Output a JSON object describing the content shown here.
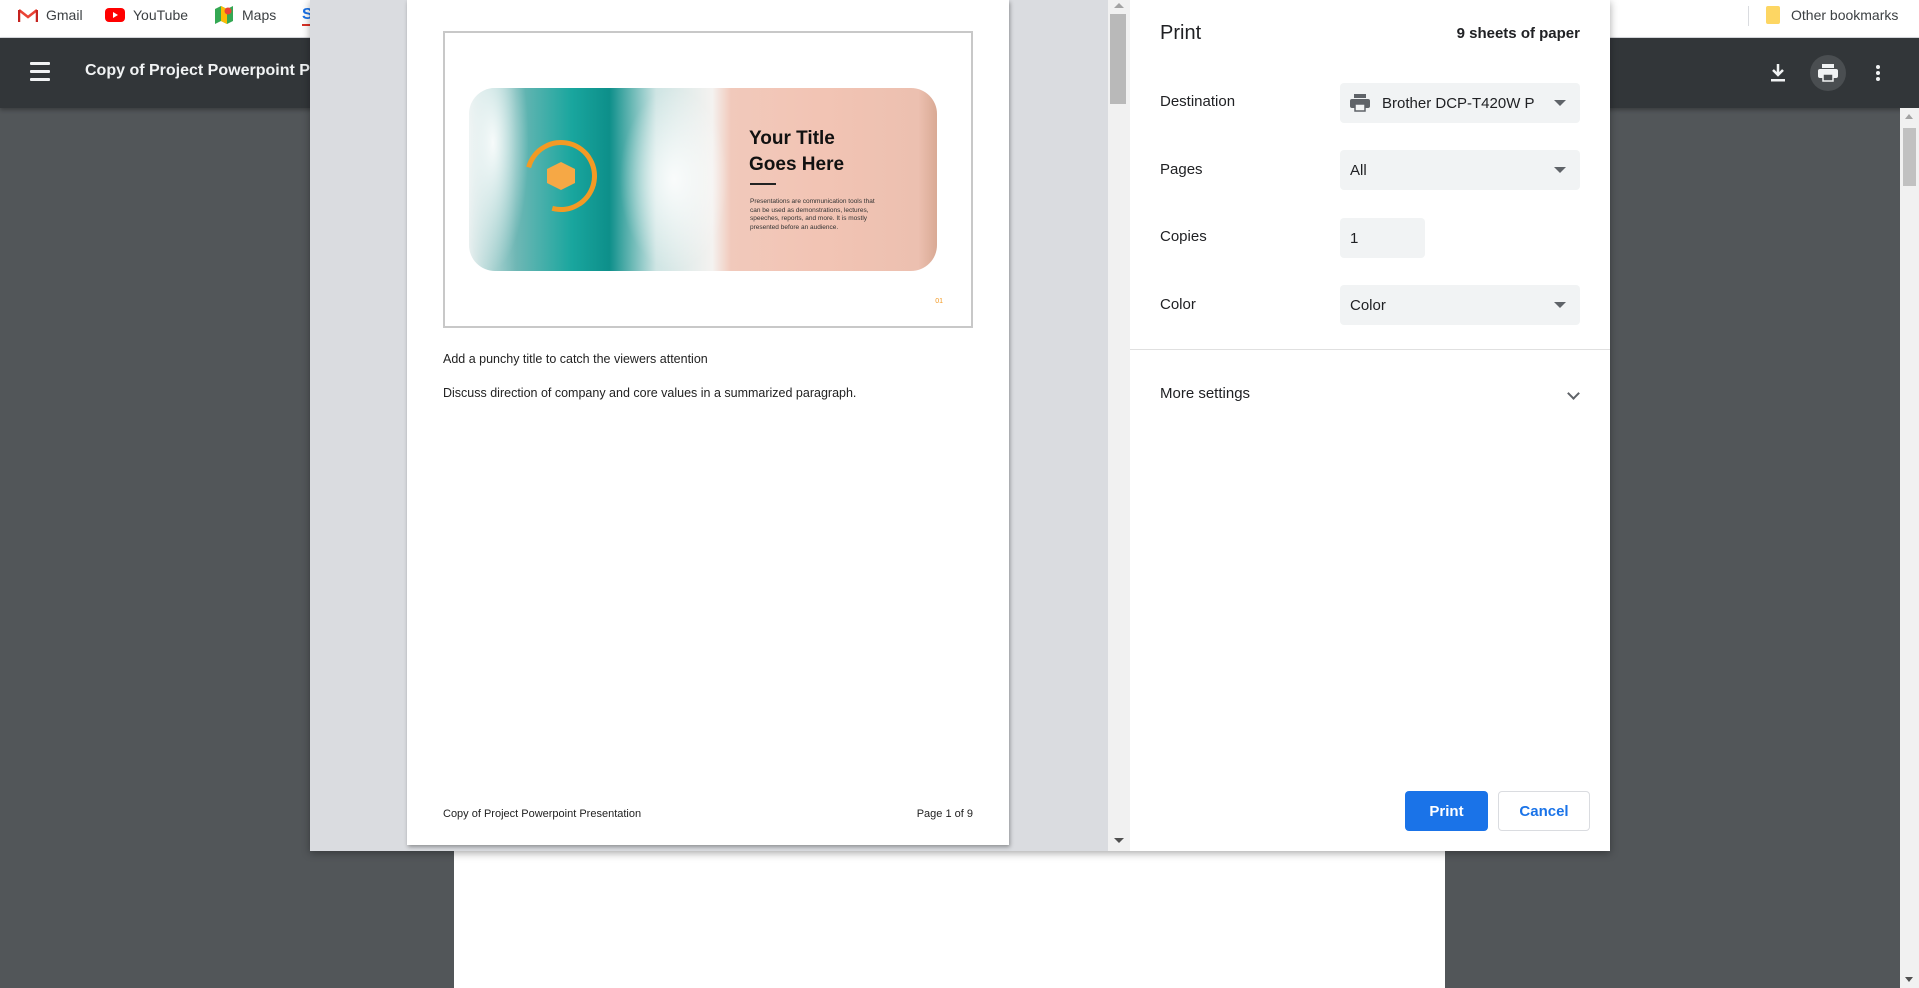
{
  "bookmarks": {
    "items": [
      {
        "label": "Gmail",
        "icon": "gmail-icon"
      },
      {
        "label": "YouTube",
        "icon": "youtube-icon"
      },
      {
        "label": "Maps",
        "icon": "maps-icon"
      }
    ],
    "other": "Other bookmarks"
  },
  "viewer": {
    "title": "Copy of Project Powerpoint P",
    "actions": [
      "download-icon",
      "print-icon",
      "more-vert-icon"
    ]
  },
  "preview": {
    "slide": {
      "title_line1": "Your Title",
      "title_line2": "Goes Here",
      "body": "Presentations are communication tools that can be used as demonstrations, lectures, speeches, reports, and more. It is mostly presented before an audience.",
      "number": "01"
    },
    "notes": [
      "Add a punchy title to catch the viewers attention",
      "Discuss direction of company and core values in a summarized paragraph."
    ],
    "footer_left": "Copy of Project Powerpoint Presentation",
    "footer_right": "Page 1 of 9"
  },
  "print": {
    "title": "Print",
    "sheets": "9 sheets of paper",
    "destination_label": "Destination",
    "destination_value": "Brother DCP-T420W P",
    "pages_label": "Pages",
    "pages_value": "All",
    "copies_label": "Copies",
    "copies_value": "1",
    "color_label": "Color",
    "color_value": "Color",
    "more_settings": "More settings",
    "print_button": "Print",
    "cancel_button": "Cancel"
  },
  "colors": {
    "accent": "#1a73e8",
    "toolbar": "#323639",
    "slide_accent": "#f39a24"
  }
}
